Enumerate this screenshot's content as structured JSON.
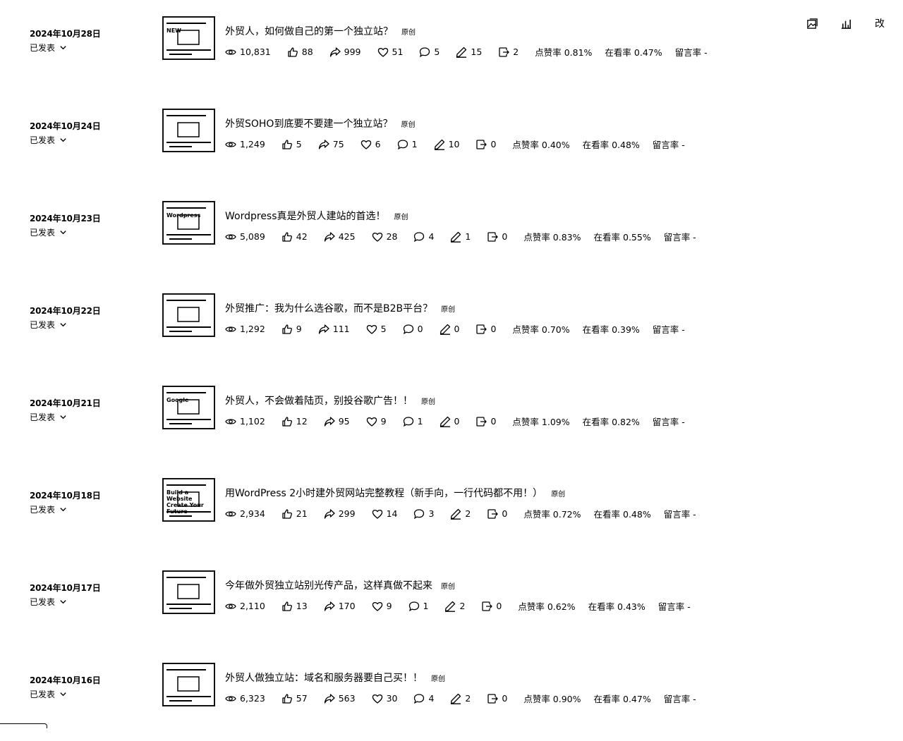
{
  "articles": [
    {
      "date": "2024年10月28日",
      "status": "已发表",
      "title": "外贸人，如何做自己的第一个独立站？",
      "tag": "原创",
      "reads": "10,831",
      "likes": "88",
      "shares": "999",
      "wows": "51",
      "comments": "5",
      "notes": "15",
      "forwards": "2",
      "like_rate": "点赞率 0.81%",
      "view_rate": "在看率 0.47%",
      "comment_rate": "留言率 -"
    },
    {
      "date": "2024年10月24日",
      "status": "已发表",
      "title": "外贸SOHO到底要不要建一个独立站？",
      "tag": "原创",
      "reads": "1,249",
      "likes": "5",
      "shares": "75",
      "wows": "6",
      "comments": "1",
      "notes": "10",
      "forwards": "0",
      "like_rate": "点赞率 0.40%",
      "view_rate": "在看率 0.48%",
      "comment_rate": "留言率 -"
    },
    {
      "date": "2024年10月23日",
      "status": "已发表",
      "title": "Wordpress真是外贸人建站的首选！",
      "tag": "原创",
      "reads": "5,089",
      "likes": "42",
      "shares": "425",
      "wows": "28",
      "comments": "4",
      "notes": "1",
      "forwards": "0",
      "like_rate": "点赞率 0.83%",
      "view_rate": "在看率 0.55%",
      "comment_rate": "留言率 -"
    },
    {
      "date": "2024年10月22日",
      "status": "已发表",
      "title": "外贸推广：我为什么选谷歌，而不是B2B平台？",
      "tag": "原创",
      "reads": "1,292",
      "likes": "9",
      "shares": "111",
      "wows": "5",
      "comments": "0",
      "notes": "0",
      "forwards": "0",
      "like_rate": "点赞率 0.70%",
      "view_rate": "在看率 0.39%",
      "comment_rate": "留言率 -"
    },
    {
      "date": "2024年10月21日",
      "status": "已发表",
      "title": "外贸人，不会做着陆页，别投谷歌广告！！",
      "tag": "原创",
      "reads": "1,102",
      "likes": "12",
      "shares": "95",
      "wows": "9",
      "comments": "1",
      "notes": "0",
      "forwards": "0",
      "like_rate": "点赞率 1.09%",
      "view_rate": "在看率 0.82%",
      "comment_rate": "留言率 -"
    },
    {
      "date": "2024年10月18日",
      "status": "已发表",
      "title": "用WordPress 2小时建外贸网站完整教程（新手向，一行代码都不用！）",
      "tag": "原创",
      "reads": "2,934",
      "likes": "21",
      "shares": "299",
      "wows": "14",
      "comments": "3",
      "notes": "2",
      "forwards": "0",
      "like_rate": "点赞率 0.72%",
      "view_rate": "在看率 0.48%",
      "comment_rate": "留言率 -"
    },
    {
      "date": "2024年10月17日",
      "status": "已发表",
      "title": "今年做外贸独立站别光传产品，这样真做不起来",
      "tag": "原创",
      "reads": "2,110",
      "likes": "13",
      "shares": "170",
      "wows": "9",
      "comments": "1",
      "notes": "2",
      "forwards": "0",
      "like_rate": "点赞率 0.62%",
      "view_rate": "在看率 0.43%",
      "comment_rate": "留言率 -"
    },
    {
      "date": "2024年10月16日",
      "status": "已发表",
      "title": "外贸人做独立站：域名和服务器要自己买！！",
      "tag": "原创",
      "reads": "6,323",
      "likes": "57",
      "shares": "563",
      "wows": "30",
      "comments": "4",
      "notes": "2",
      "forwards": "0",
      "like_rate": "点赞率 0.90%",
      "view_rate": "在看率 0.47%",
      "comment_rate": "留言率 -"
    }
  ],
  "row_actions": {
    "edit_label": "改"
  },
  "thumbnails": [
    {
      "caption": "NEW"
    },
    {
      "caption": ""
    },
    {
      "caption": "Wordpress"
    },
    {
      "caption": ""
    },
    {
      "caption": "Google"
    },
    {
      "caption": "Build a Website Create Your Future"
    },
    {
      "caption": ""
    },
    {
      "caption": ""
    }
  ]
}
